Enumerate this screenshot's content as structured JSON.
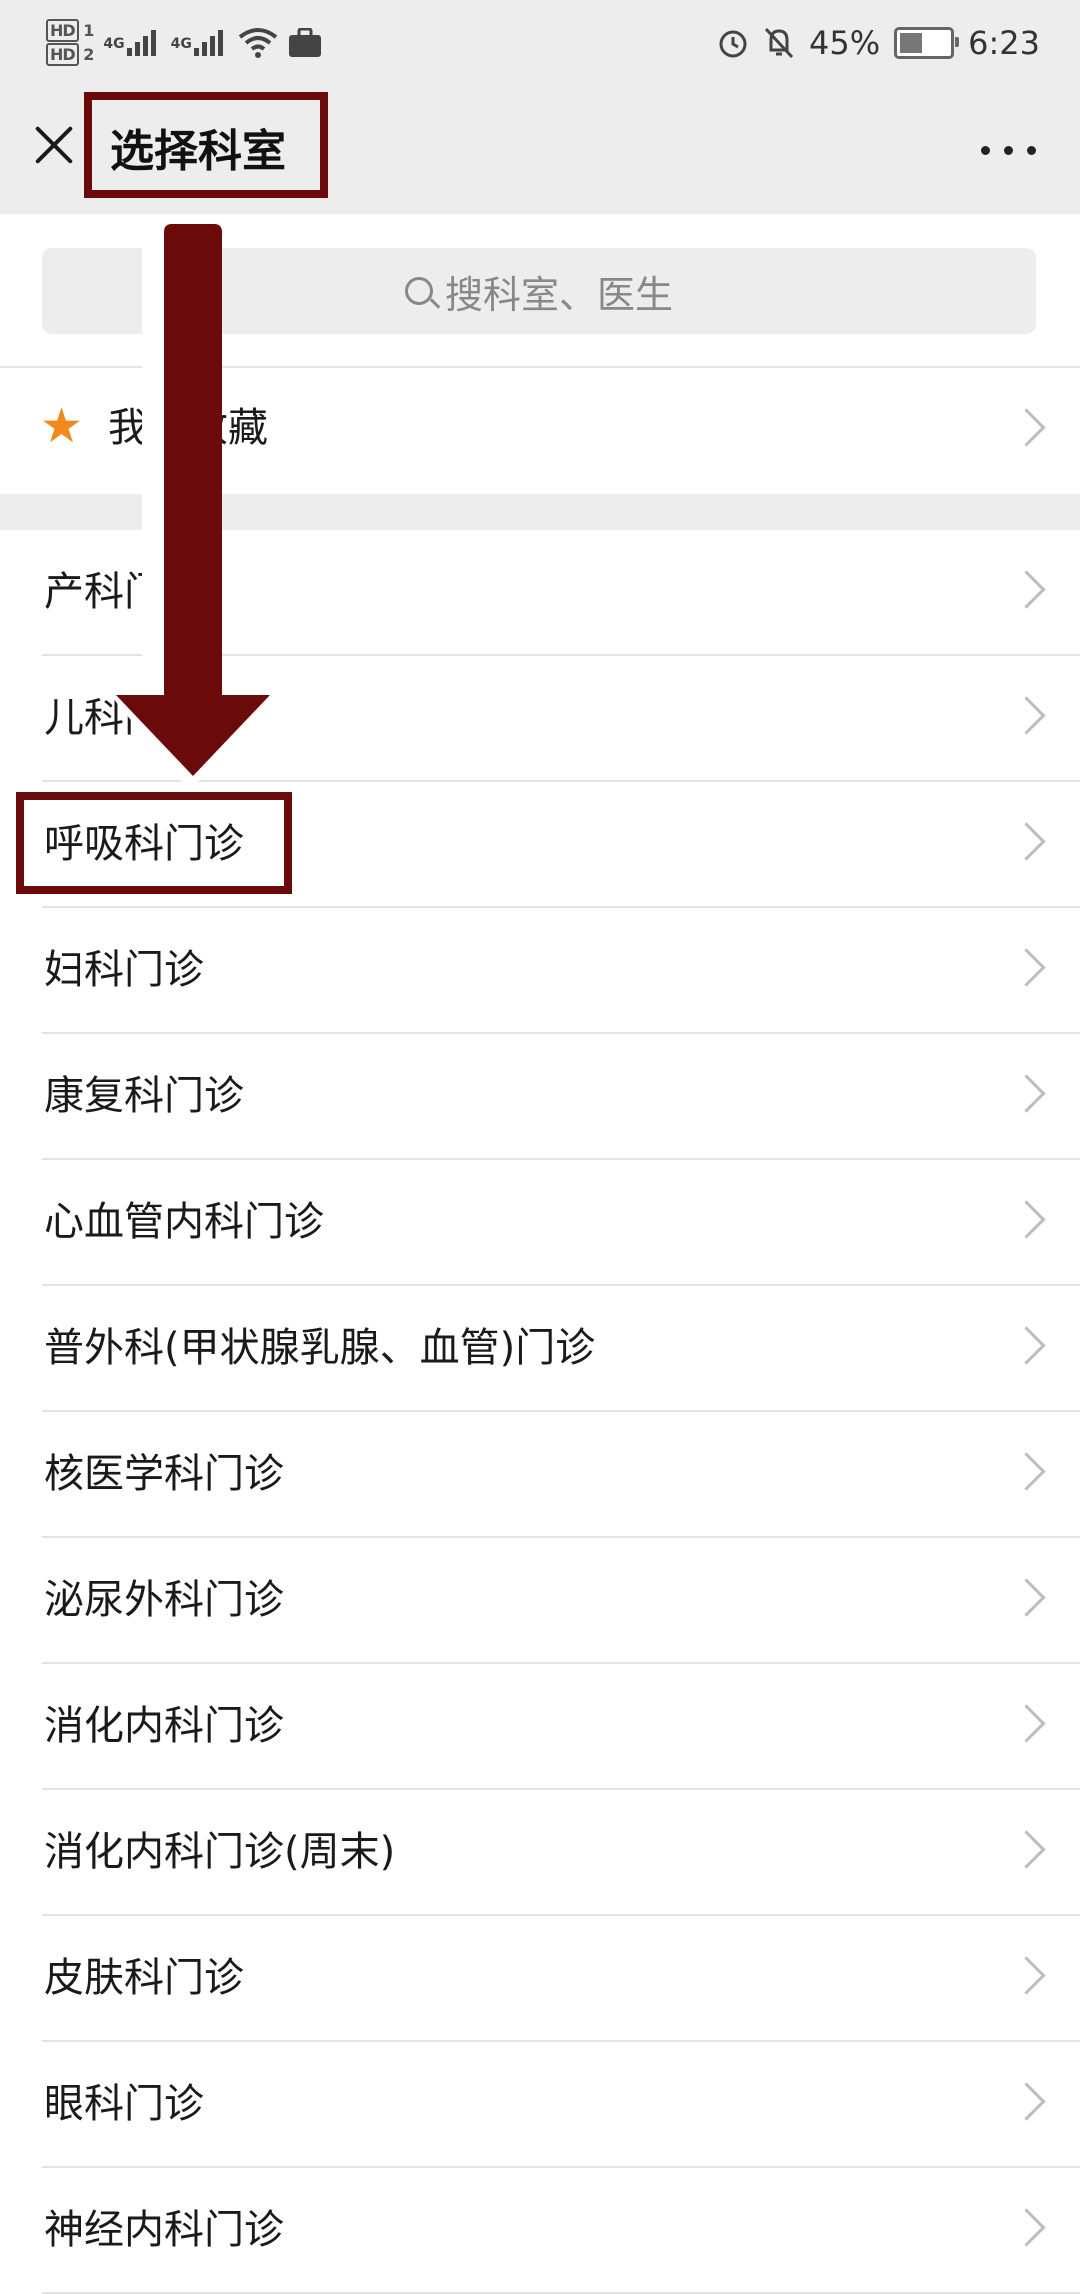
{
  "status_bar": {
    "hd1": "HD",
    "hd2": "HD",
    "sim1": "1",
    "sim2": "2",
    "net1": "4G",
    "net2": "4G",
    "battery": "45%",
    "battery_level": 0.45,
    "time": "6:23",
    "icons": [
      "alarm-icon",
      "mute-bell-icon",
      "wifi-icon",
      "briefcase-icon"
    ]
  },
  "nav": {
    "title": "选择科室",
    "close_icon": "close-icon",
    "more_icon": "more-icon"
  },
  "search": {
    "placeholder": "搜科室、医生"
  },
  "favorites": {
    "label": "我的收藏",
    "visible_label": "我    藏"
  },
  "departments": [
    "产科门诊",
    "儿科门诊",
    "呼吸科门诊",
    "妇科门诊",
    "康复科门诊",
    "心血管内科门诊",
    "普外科(甲状腺乳腺、血管)门诊",
    "核医学科门诊",
    "泌尿外科门诊",
    "消化内科门诊",
    "消化内科门诊(周末)",
    "皮肤科门诊",
    "眼科门诊",
    "神经内科门诊"
  ],
  "annotation": {
    "color": "#6b0a0a",
    "highlighted_item": "呼吸科门诊"
  },
  "colors": {
    "star": "#f08a1e",
    "header_bg": "#ededed"
  }
}
